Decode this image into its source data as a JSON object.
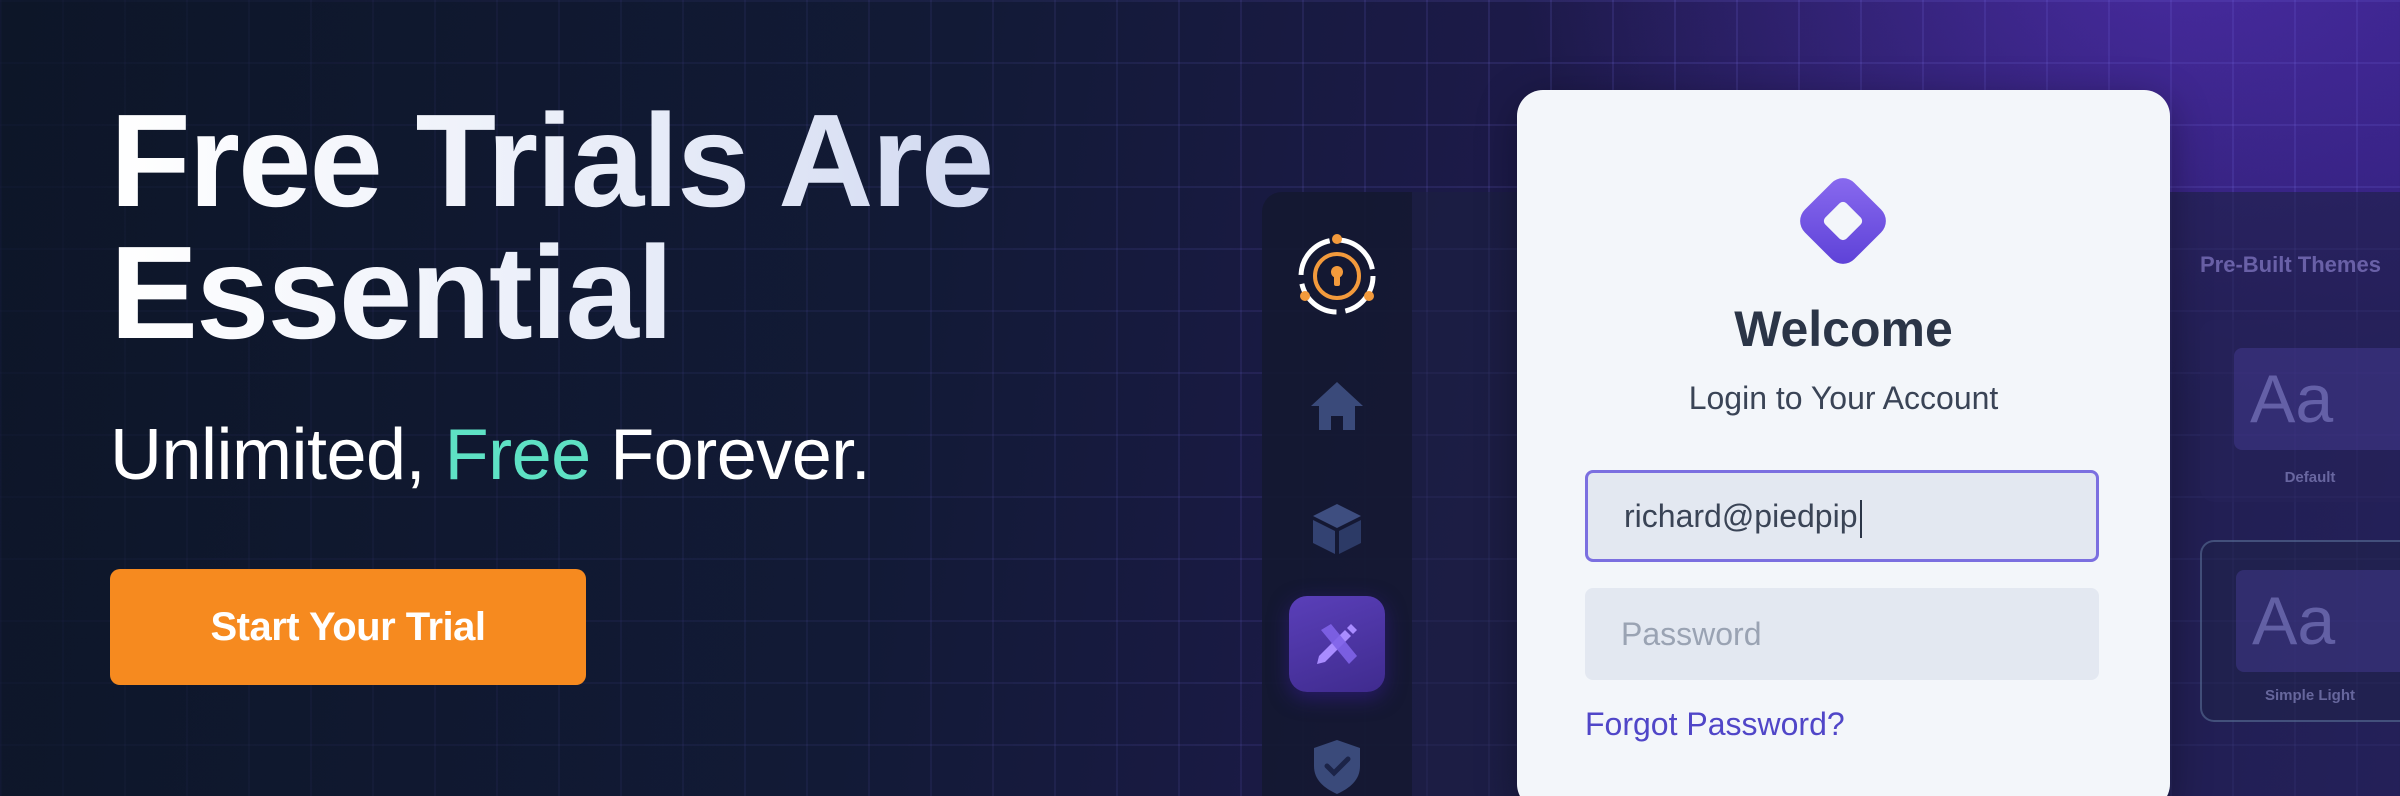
{
  "hero": {
    "title_line1": "Free Trials Are",
    "title_line2": "Essential",
    "sub_before": "Unlimited,",
    "sub_accent": "Free",
    "sub_after": "Forever.",
    "cta_label": "Start Your Trial"
  },
  "sidebar": {
    "items": [
      {
        "icon": "keyhole-logo-icon"
      },
      {
        "icon": "home-icon"
      },
      {
        "icon": "box-icon"
      },
      {
        "icon": "pencil-ruler-icon",
        "active": true
      },
      {
        "icon": "shield-check-icon"
      }
    ]
  },
  "login": {
    "title": "Welcome",
    "subtitle": "Login to Your Account",
    "email_value": "richard@piedpip",
    "password_placeholder": "Password",
    "forgot_label": "Forgot Password?"
  },
  "themes": {
    "title": "Pre-Built Themes",
    "cards": [
      {
        "preview": "Aa",
        "label": "Default"
      },
      {
        "preview": "Aa",
        "label": "Simple Light"
      }
    ]
  },
  "colors": {
    "cta": "#f68a1f",
    "accent_text": "#5ee1c4",
    "link": "#5046c8",
    "focus_border": "#7b6fe0"
  }
}
